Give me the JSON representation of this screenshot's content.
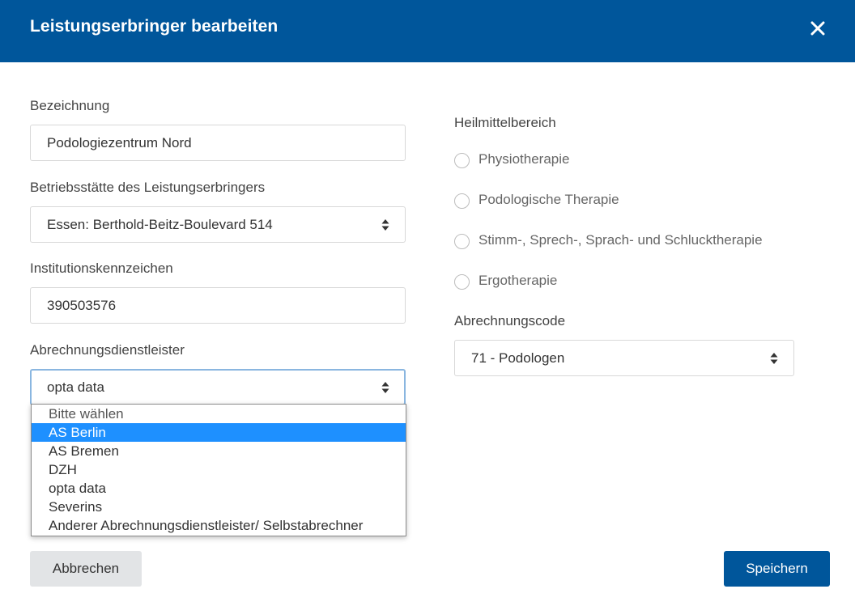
{
  "dialog": {
    "title": "Leistungserbringer bearbeiten"
  },
  "form": {
    "bezeichnung": {
      "label": "Bezeichnung",
      "value": "Podologiezentrum Nord"
    },
    "betriebsstaette": {
      "label": "Betriebsstätte des Leistungserbringers",
      "value": "Essen: Berthold-Beitz-Boulevard 514"
    },
    "ik": {
      "label": "Institutionskennzeichen",
      "value": "390503576"
    },
    "abrechnungsdienstleister": {
      "label": "Abrechnungsdienstleister",
      "value": "opta data",
      "options": [
        "Bitte wählen",
        "AS Berlin",
        "AS Bremen",
        "DZH",
        "opta data",
        "Severins",
        "Anderer Abrechnungsdienstleister/ Selbstabrechner"
      ],
      "highlighted_option": "AS Berlin"
    },
    "heilmittelbereich": {
      "label": "Heilmittelbereich",
      "options": [
        "Physiotherapie",
        "Podologische Therapie",
        "Stimm-, Sprech-, Sprach- und Schlucktherapie",
        "Ergotherapie"
      ]
    },
    "abrechnungscode": {
      "label": "Abrechnungscode",
      "value": "71 - Podologen"
    }
  },
  "buttons": {
    "cancel": "Abbrechen",
    "save": "Speichern"
  },
  "colors": {
    "header": "#00569b",
    "highlight": "#1e90ff"
  }
}
